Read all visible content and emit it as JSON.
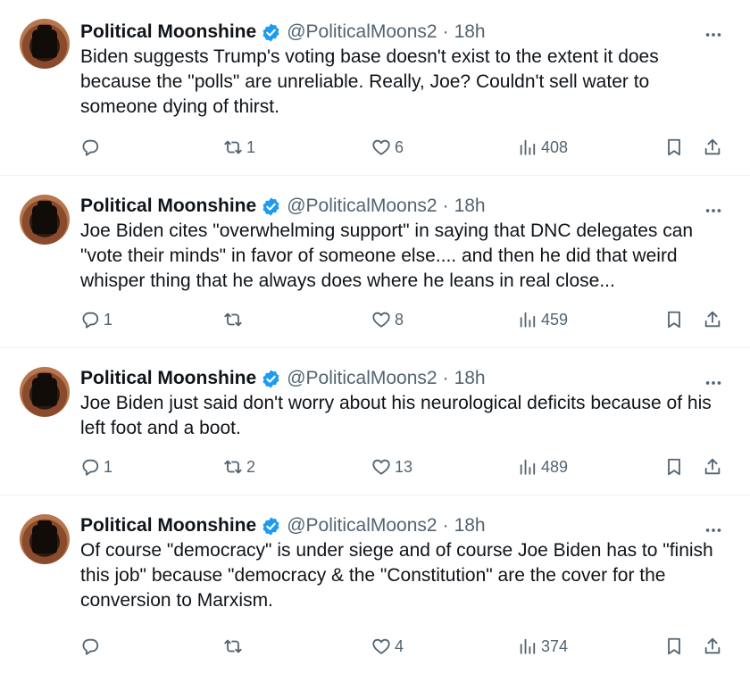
{
  "tweets": [
    {
      "name": "Political Moonshine",
      "handle": "@PoliticalMoons2",
      "time": "18h",
      "text": "Biden suggests Trump's voting base doesn't exist to the extent it does because the \"polls\" are unreliable. Really, Joe? Couldn't sell water to someone dying of thirst.",
      "replies": "",
      "retweets": "1",
      "likes": "6",
      "views": "408"
    },
    {
      "name": "Political Moonshine",
      "handle": "@PoliticalMoons2",
      "time": "18h",
      "text": "Joe Biden cites \"overwhelming support\" in saying that DNC delegates can \"vote their minds\" in favor of someone else.... and then he did that weird whisper thing that he always does where he leans in real close...",
      "replies": "1",
      "retweets": "",
      "likes": "8",
      "views": "459"
    },
    {
      "name": "Political Moonshine",
      "handle": "@PoliticalMoons2",
      "time": "18h",
      "text": "Joe Biden just said don't worry about his neurological deficits because of his left foot and a boot.",
      "replies": "1",
      "retweets": "2",
      "likes": "13",
      "views": "489"
    },
    {
      "name": "Political Moonshine",
      "handle": "@PoliticalMoons2",
      "time": "18h",
      "text": "Of course \"democracy\" is under siege and of course Joe Biden has to \"finish this job\" because \"democracy & the \"Constitution\" are the cover for the conversion to Marxism.",
      "replies": "",
      "retweets": "",
      "likes": "4",
      "views": "374"
    }
  ],
  "separator": "·",
  "icons": {
    "verified": "verified-badge-icon",
    "reply": "reply-icon",
    "retweet": "retweet-icon",
    "like": "heart-icon",
    "views": "views-icon",
    "bookmark": "bookmark-icon",
    "share": "share-icon",
    "more": "more-icon"
  },
  "colors": {
    "verified": "#1d9bf0",
    "text": "#0f1419",
    "muted": "#536471"
  }
}
